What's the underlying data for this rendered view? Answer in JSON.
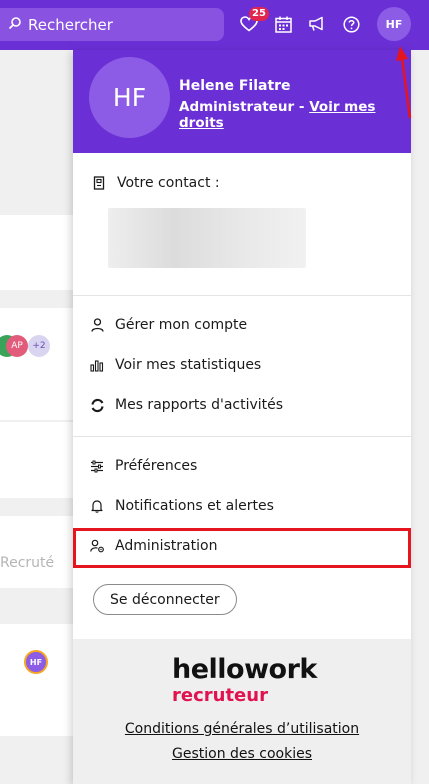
{
  "topbar": {
    "search_placeholder": "Rechercher",
    "notifications_count": "25",
    "user_initials": "HF",
    "accent_color": "#6b2fd6"
  },
  "background": {
    "chips": [
      "AP",
      "+2"
    ],
    "status_text": "Recruté",
    "row_avatar": "HF"
  },
  "dropdown": {
    "user": {
      "initials": "HF",
      "name": "Helene Filatre",
      "role": "Administrateur",
      "role_separator": " - ",
      "rights_link": "Voir mes droits"
    },
    "contact_label": "Votre contact :",
    "account_items": [
      {
        "label": "Gérer mon compte",
        "icon": "user-icon"
      },
      {
        "label": "Voir mes statistiques",
        "icon": "bar-chart-icon"
      },
      {
        "label": "Mes rapports d'activités",
        "icon": "refresh-icon"
      }
    ],
    "settings_items": [
      {
        "label": "Préférences",
        "icon": "sliders-icon"
      },
      {
        "label": "Notifications et alertes",
        "icon": "bell-icon"
      },
      {
        "label": "Administration",
        "icon": "admin-icon"
      }
    ],
    "logout_label": "Se déconnecter",
    "footer": {
      "logo_line1": "hellowork",
      "logo_line2": "recruteur",
      "links": [
        "Conditions générales d’utilisation",
        "Gestion des cookies"
      ]
    }
  },
  "highlight_color": "#e4151f"
}
